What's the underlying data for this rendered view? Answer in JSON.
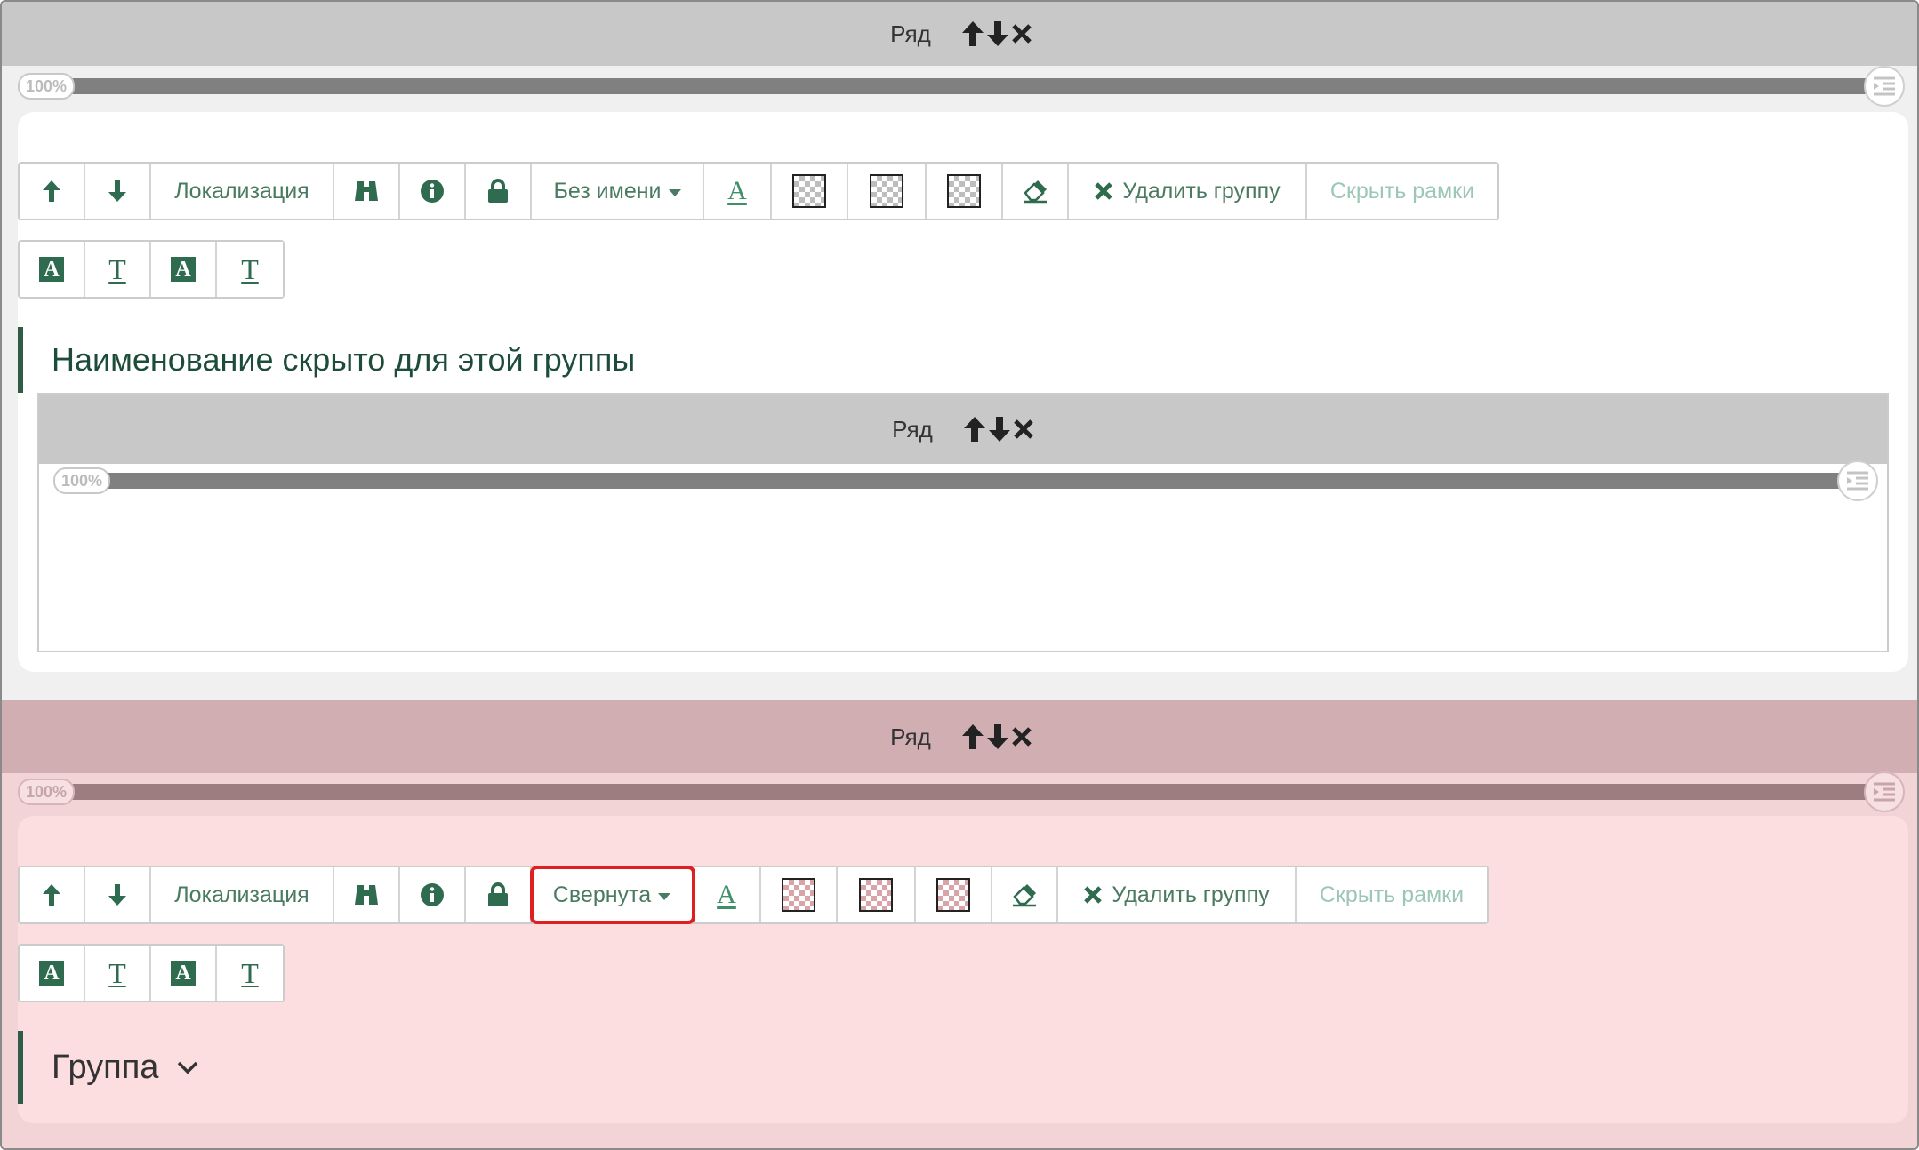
{
  "rows": [
    {
      "header": {
        "label": "Ряд",
        "bg": "#c8c8c8"
      },
      "slider": {
        "percent_label": "100%"
      },
      "group": {
        "toolbar": {
          "localization": "Локализация",
          "name_mode": "Без имени",
          "delete_group": "Удалить группу",
          "hide_frames": "Скрыть рамки"
        },
        "title": "Наименование скрыто для этой группы",
        "inner_row": {
          "header": {
            "label": "Ряд"
          },
          "slider": {
            "percent_label": "100%"
          }
        }
      }
    },
    {
      "header": {
        "label": "Ряд",
        "bg": "#d0aeb2"
      },
      "slider": {
        "percent_label": "100%"
      },
      "group": {
        "toolbar": {
          "localization": "Локализация",
          "name_mode": "Свернута",
          "delete_group": "Удалить группу",
          "hide_frames": "Скрыть рамки"
        },
        "title": "Группа"
      }
    }
  ],
  "colors": {
    "accent_green": "#2f6b4f",
    "selection_red": "#e02020",
    "pink_bg": "#f2d3d6",
    "pink_group": "#fcdde0"
  }
}
